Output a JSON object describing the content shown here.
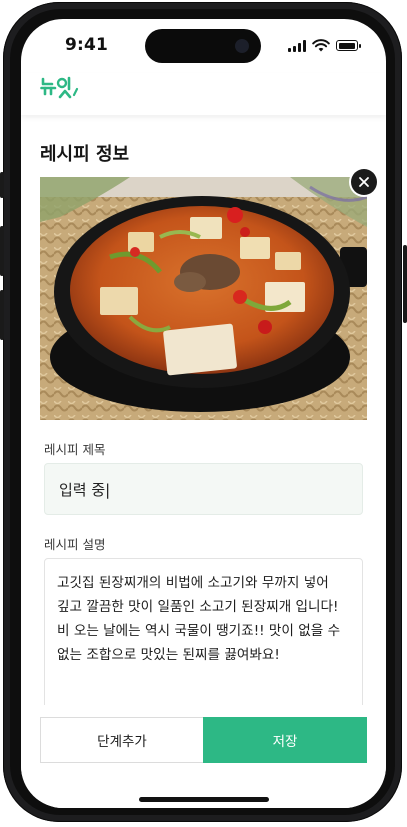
{
  "status_bar": {
    "time": "9:41"
  },
  "app": {
    "logo_text": "뉴잇",
    "brand_color": "#2db885"
  },
  "page": {
    "title": "레시피 정보"
  },
  "photo": {
    "alt": "된장찌개"
  },
  "form": {
    "title_label": "레시피 제목",
    "title_value": "입력 중|",
    "description_label": "레시피 설명",
    "description_value": "고깃집 된장찌개의 비법에 소고기와 무까지 넣어\n깊고 깔끔한 맛이 일품인 소고기 된장찌개 입니다!\n비 오는 날에는 역시 국물이 땡기죠!! 맛이 없을 수\n없는 조합으로 맛있는 된찌를 끓여봐요!"
  },
  "actions": {
    "add_step_label": "단계추가",
    "save_label": "저장"
  },
  "icons": {
    "close": "close-icon"
  }
}
